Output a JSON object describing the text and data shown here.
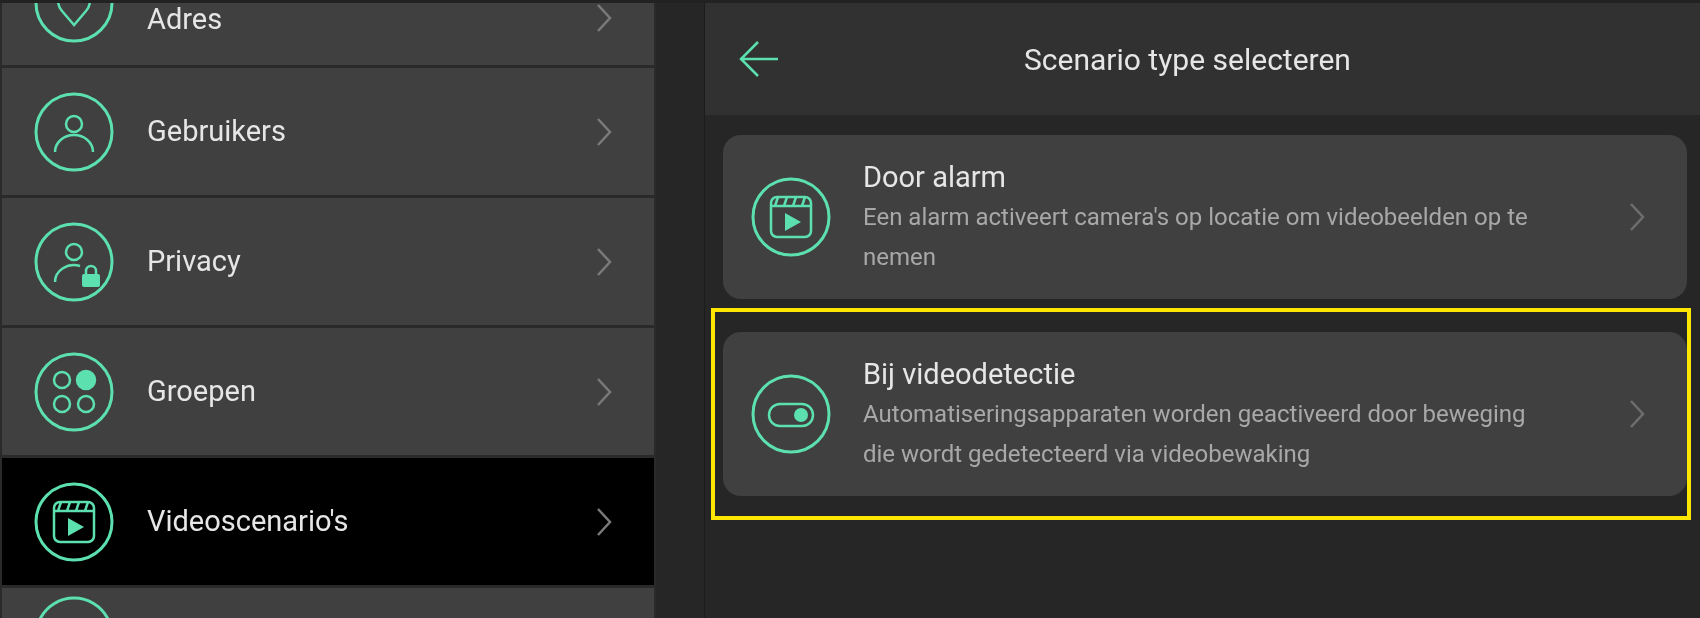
{
  "sidebar": {
    "items": [
      {
        "label": "Adres",
        "kind": "pin",
        "selected": false
      },
      {
        "label": "Gebruikers",
        "kind": "user",
        "selected": false
      },
      {
        "label": "Privacy",
        "kind": "user-lock",
        "selected": false
      },
      {
        "label": "Groepen",
        "kind": "groups",
        "selected": false
      },
      {
        "label": "Videoscenario's",
        "kind": "video",
        "selected": true
      },
      {
        "kind": "partial",
        "selected": false
      }
    ]
  },
  "header": {
    "title": "Scenario type selecteren"
  },
  "options": [
    {
      "title": "Door alarm",
      "description": "Een alarm activeert camera's op locatie om videobeelden op te nemen",
      "kind": "video",
      "highlighted": false
    },
    {
      "title": "Bij videodetectie",
      "description": "Automatiseringsapparaten worden geactiveerd door beweging die wordt gedetecteerd via videobewaking",
      "kind": "toggle",
      "highlighted": true
    }
  ]
}
